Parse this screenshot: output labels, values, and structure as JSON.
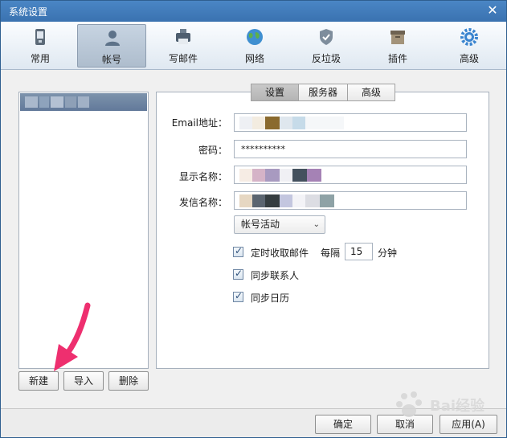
{
  "window": {
    "title": "系统设置",
    "close_icon": "close-icon"
  },
  "toolbar": {
    "items": [
      {
        "label": "常用",
        "icon": "phone-icon"
      },
      {
        "label": "帐号",
        "icon": "user-icon"
      },
      {
        "label": "写邮件",
        "icon": "compose-icon"
      },
      {
        "label": "网络",
        "icon": "globe-icon"
      },
      {
        "label": "反垃圾",
        "icon": "shield-icon"
      },
      {
        "label": "插件",
        "icon": "plugin-box-icon"
      },
      {
        "label": "高级",
        "icon": "gear-icon"
      }
    ],
    "active_index": 1
  },
  "left_buttons": {
    "new": "新建",
    "import": "导入",
    "delete": "删除"
  },
  "tabs": {
    "items": [
      "设置",
      "服务器",
      "高级"
    ],
    "active_index": 0
  },
  "form": {
    "email_label": "Email地址：",
    "password_label": "密码：",
    "password_value": "**********",
    "display_name_label": "显示名称：",
    "sender_name_label": "发信名称：",
    "account_status": "帐号活动",
    "timed_fetch_label": "定时收取邮件",
    "interval_prefix": "每隔",
    "interval_value": "15",
    "interval_unit": "分钟",
    "sync_contacts_label": "同步联系人",
    "sync_calendar_label": "同步日历"
  },
  "bottom_buttons": {
    "ok": "确定",
    "cancel": "取消",
    "apply": "应用(A)"
  },
  "watermark": "Bai经验"
}
